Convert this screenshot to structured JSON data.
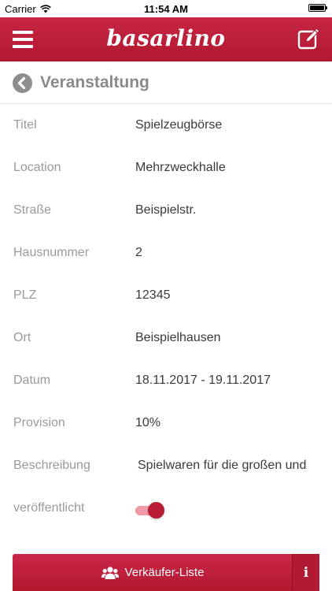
{
  "status_bar": {
    "carrier": "Carrier",
    "time": "11:54 AM"
  },
  "header": {
    "logo": "basarlino"
  },
  "section": {
    "title": "Veranstaltung"
  },
  "fields": [
    {
      "label": "Titel",
      "value": "Spielzeugbörse"
    },
    {
      "label": "Location",
      "value": "Mehrzweckhalle"
    },
    {
      "label": "Straße",
      "value": "Beispielstr."
    },
    {
      "label": "Hausnummer",
      "value": "2"
    },
    {
      "label": "PLZ",
      "value": "12345"
    },
    {
      "label": "Ort",
      "value": "Beispielhausen"
    },
    {
      "label": "Datum",
      "value": "18.11.2017 - 19.11.2017"
    },
    {
      "label": "Provision",
      "value": "10%"
    },
    {
      "label": "Beschreibung",
      "value": "Spielwaren für die großen und"
    }
  ],
  "published": {
    "label": "veröffentlicht",
    "checked": true
  },
  "bottom_button": {
    "label": "Verkäufer-Liste",
    "info_label": "i"
  },
  "colors": {
    "brand": "#be2038",
    "label_gray": "#9a9a9a",
    "value_dark": "#3a3a3a"
  }
}
